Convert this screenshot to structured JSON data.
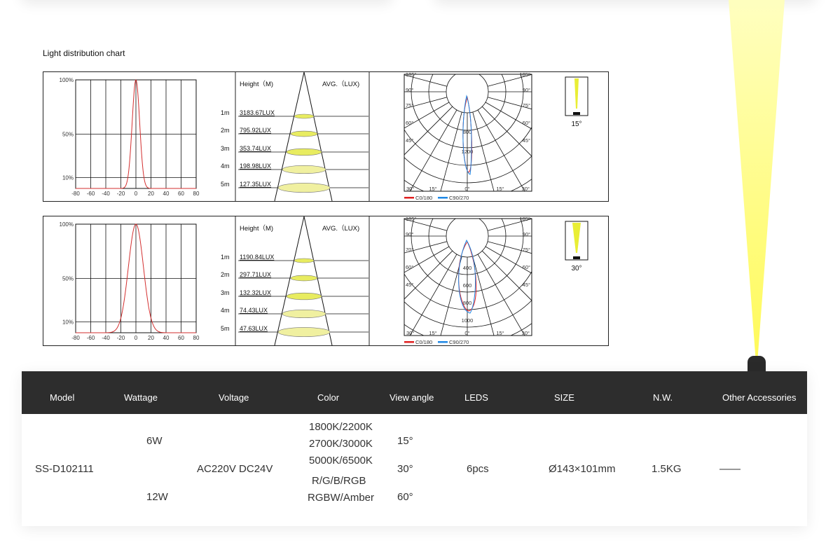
{
  "section_title": "Light distribution chart",
  "panels": [
    {
      "curve_ticks_y": [
        "100%",
        "50%",
        "10%"
      ],
      "curve_ticks_x": [
        "-80",
        "-60",
        "-40",
        "-20",
        "0",
        "20",
        "40",
        "60",
        "80"
      ],
      "curve_width": 5,
      "height_label": "Height（M)",
      "avg_label": "AVG.（LUX)",
      "rows": [
        {
          "h": "1m",
          "lux": "3183.67LUX"
        },
        {
          "h": "2m",
          "lux": "795.92LUX"
        },
        {
          "h": "3m",
          "lux": "353.74LUX"
        },
        {
          "h": "4m",
          "lux": "198.98LUX"
        },
        {
          "h": "5m",
          "lux": "127.35LUX"
        }
      ],
      "polar_top_left": [
        "105°",
        "90°",
        "75°",
        "60°",
        "45°"
      ],
      "polar_top_right": [
        "105°",
        "90°",
        "75°",
        "60°",
        "45°"
      ],
      "polar_bottom": [
        "30°",
        "15°",
        "0°",
        "15°",
        "30°"
      ],
      "polar_radial": [
        "800",
        "1200"
      ],
      "legend_c0": "C0/180",
      "legend_c90": "C90/270",
      "angle_label": "15°",
      "beam_half": 3
    },
    {
      "curve_ticks_y": [
        "100%",
        "50%",
        "10%"
      ],
      "curve_ticks_x": [
        "-80",
        "-60",
        "-40",
        "-20",
        "0",
        "20",
        "40",
        "60",
        "80"
      ],
      "curve_width": 10,
      "height_label": "Height（M)",
      "avg_label": "AVG.（LUX)",
      "rows": [
        {
          "h": "1m",
          "lux": "1190.84LUX"
        },
        {
          "h": "2m",
          "lux": "297.71LUX"
        },
        {
          "h": "3m",
          "lux": "132.32LUX"
        },
        {
          "h": "4m",
          "lux": "74.43LUX"
        },
        {
          "h": "5m",
          "lux": "47.63LUX"
        }
      ],
      "polar_top_left": [
        "105°",
        "90°",
        "70°",
        "60°",
        "45°"
      ],
      "polar_top_right": [
        "105°",
        "90°",
        "75°",
        "60°",
        "45°"
      ],
      "polar_bottom": [
        "30°",
        "15°",
        "0°",
        "15°",
        "30°"
      ],
      "polar_radial": [
        "400",
        "600",
        "800",
        "1000"
      ],
      "legend_c0": "C0/180",
      "legend_c90": "C90/270",
      "angle_label": "30°",
      "beam_half": 6
    }
  ],
  "colors": {
    "c0": "#e02020",
    "c90": "#1e88e5",
    "curve": "#d32f2f",
    "lux_fill": "#f0f0a0",
    "header_bg": "#2d2d2d"
  },
  "spec": {
    "headers": [
      "Model",
      "Wattage",
      "Voltage",
      "Color",
      "View angle",
      "LEDS",
      "SIZE",
      "N.W.",
      "Other Accessories"
    ],
    "model": "SS-D102111",
    "wattage": [
      "6W",
      "12W"
    ],
    "voltage": "AC220V  DC24V",
    "color": [
      "1800K/2200K",
      "2700K/3000K",
      "5000K/6500K",
      "R/G/B/RGB",
      "RGBW/Amber"
    ],
    "view_angle": [
      "15°",
      "30°",
      "60°"
    ],
    "leds": "6pcs",
    "size": "Ø143×101mm",
    "nw": "1.5KG",
    "other": "——"
  }
}
